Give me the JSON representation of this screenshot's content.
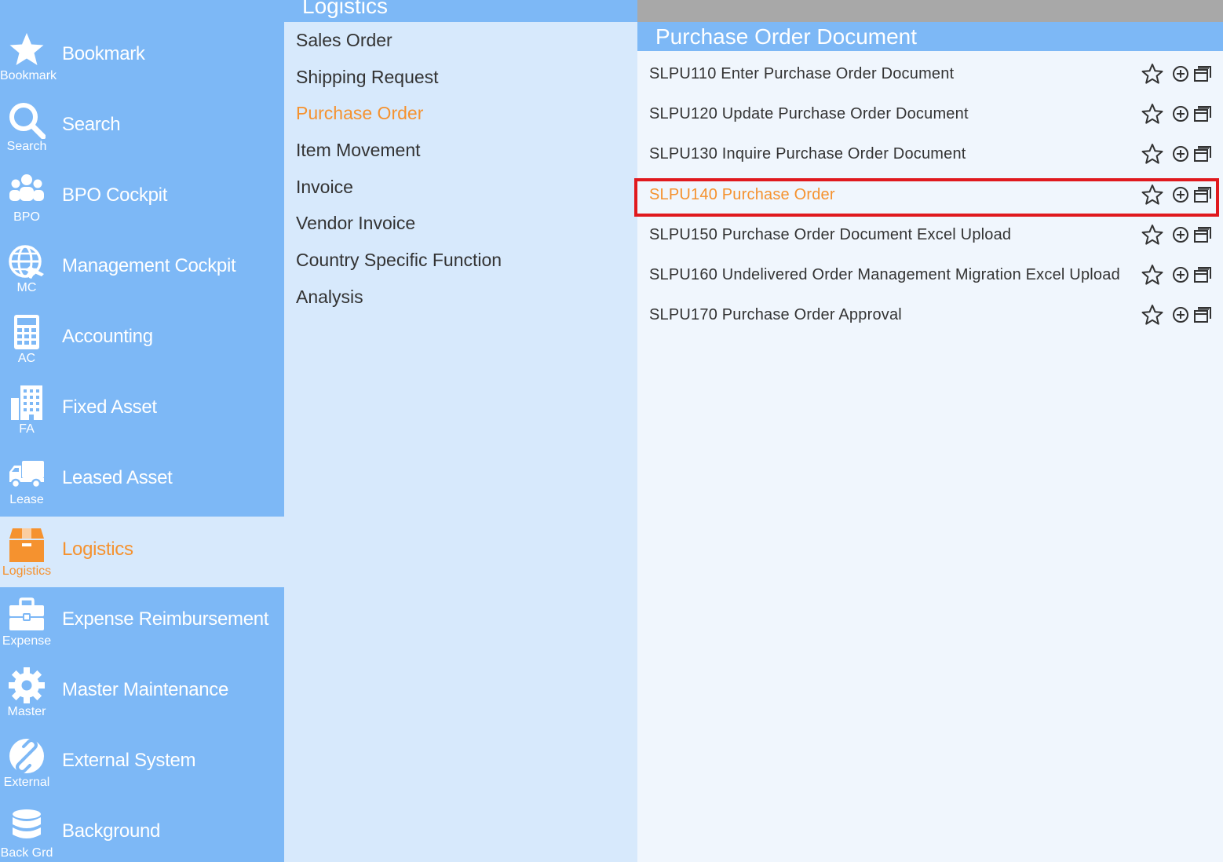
{
  "sidebar": {
    "items": [
      {
        "label": "Bookmark",
        "short": "Bookmark",
        "icon": "star-icon"
      },
      {
        "label": "Search",
        "short": "Search",
        "icon": "search-icon"
      },
      {
        "label": "BPO Cockpit",
        "short": "BPO",
        "icon": "users-icon"
      },
      {
        "label": "Management Cockpit",
        "short": "MC",
        "icon": "globe-plane-icon"
      },
      {
        "label": "Accounting",
        "short": "AC",
        "icon": "calculator-icon"
      },
      {
        "label": "Fixed Asset",
        "short": "FA",
        "icon": "building-icon"
      },
      {
        "label": "Leased Asset",
        "short": "Lease",
        "icon": "truck-icon"
      },
      {
        "label": "Logistics",
        "short": "Logistics",
        "icon": "box-icon"
      },
      {
        "label": "Expense Reimbursement",
        "short": "Expense",
        "icon": "briefcase-icon"
      },
      {
        "label": "Master Maintenance",
        "short": "Master",
        "icon": "gear-icon"
      },
      {
        "label": "External System",
        "short": "External",
        "icon": "link-icon"
      },
      {
        "label": "Background",
        "short": "Back Grd",
        "icon": "database-icon"
      }
    ],
    "active": "Logistics"
  },
  "submenu": {
    "title": "Logistics",
    "items": [
      "Sales Order",
      "Shipping Request",
      "Purchase Order",
      "Item Movement",
      "Invoice",
      "Vendor Invoice",
      "Country Specific Function",
      "Analysis"
    ],
    "active": "Purchase Order"
  },
  "content": {
    "title": "Purchase Order Document",
    "programs": [
      "SLPU110 Enter Purchase Order Document",
      "SLPU120 Update Purchase Order Document",
      "SLPU130 Inquire Purchase Order Document",
      "SLPU140 Purchase Order",
      "SLPU150 Purchase Order Document Excel Upload",
      "SLPU160 Undelivered Order Management Migration Excel Upload",
      "SLPU170 Purchase Order Approval"
    ],
    "active": "SLPU140 Purchase Order"
  },
  "colors": {
    "sidebar_bg": "#7db8f6",
    "submenu_bg": "#d7e9fc",
    "content_bg": "#f0f6fd",
    "accent_orange": "#f5922f",
    "highlight_red": "#e0191e"
  }
}
